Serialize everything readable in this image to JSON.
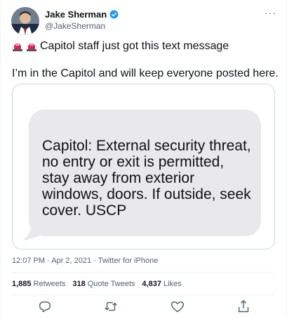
{
  "author": {
    "name": "Jake Sherman",
    "handle": "@JakeSherman"
  },
  "tweet": {
    "line1": "Capitol staff just got this text message",
    "line2": "I’m in the Capitol and will keep everyone posted here."
  },
  "media": {
    "message_text": "Capitol: External security threat, no entry or exit is permitted, stay away from exterior windows, doors. If outside, seek cover. USCP"
  },
  "meta": {
    "timestamp": "12:07 PM · Apr 2, 2021",
    "separator": " · ",
    "source": "Twitter for iPhone"
  },
  "stats": {
    "retweets_count": "1,885",
    "retweets_label": "Retweets",
    "quotes_count": "318",
    "quotes_label": "Quote Tweets",
    "likes_count": "4,837",
    "likes_label": "Likes"
  },
  "icons": {
    "verified": "verified-badge-icon",
    "siren": "police-siren-icon",
    "more": "more-options-icon",
    "reply": "reply-icon",
    "retweet": "retweet-icon",
    "like": "heart-icon",
    "share": "share-icon"
  },
  "colors": {
    "verified_blue": "#1d9bf0",
    "bubble_gray": "#e9e9eb",
    "secondary_text": "#536471"
  }
}
